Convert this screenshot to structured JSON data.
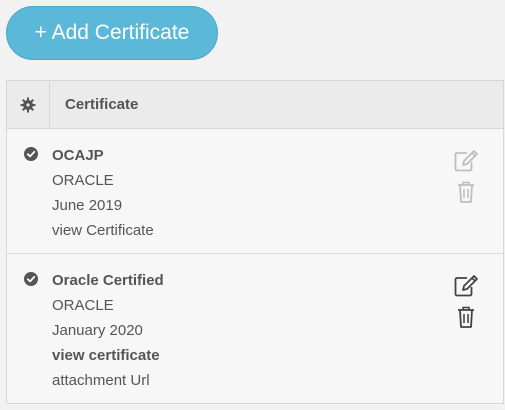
{
  "toolbar": {
    "add_label": "+ Add Certificate"
  },
  "table": {
    "header": {
      "icon": "gear-icon",
      "label": "Certificate"
    },
    "rows": [
      {
        "status_icon": "check-circle-icon",
        "title": "OCAJP",
        "issuer": "ORACLE",
        "date": "June 2019",
        "link": "view Certificate",
        "edit_icon": "edit-icon",
        "delete_icon": "trash-icon",
        "actions_enabled": false
      },
      {
        "status_icon": "check-circle-icon",
        "title": "Oracle Certified",
        "issuer": "ORACLE",
        "date": "January 2020",
        "link": "view certificate",
        "attachment": "attachment Url",
        "edit_icon": "edit-icon",
        "delete_icon": "trash-icon",
        "actions_enabled": true
      }
    ]
  },
  "colors": {
    "button_bg": "#5bb8d8",
    "text": "#555555",
    "border": "#d7d7d7",
    "header_bg": "#ebebeb"
  }
}
